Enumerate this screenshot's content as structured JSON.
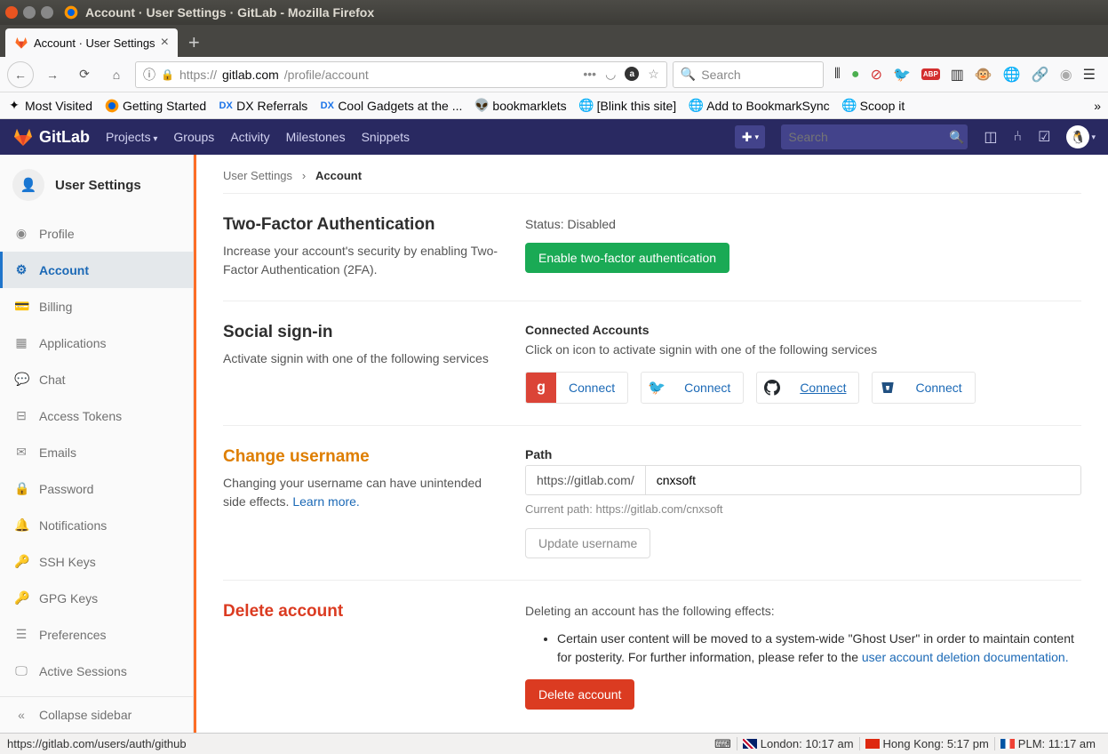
{
  "os": {
    "window_title": "Account · User Settings · GitLab - Mozilla Firefox"
  },
  "browser": {
    "tab_title": "Account · User Settings",
    "url_display": "https://gitlab.com/profile/account",
    "url_host": "gitlab.com",
    "url_protocol": "https://",
    "url_path": "/profile/account",
    "search_placeholder": "Search",
    "bookmarks": {
      "b0": "Most Visited",
      "b1": "Getting Started",
      "b2": "DX Referrals",
      "b3": "Cool Gadgets at the ...",
      "b4": "bookmarklets",
      "b5": "[Blink this site]",
      "b6": "Add to BookmarkSync",
      "b7": "Scoop it"
    }
  },
  "gitlab": {
    "brand": "GitLab",
    "nav": {
      "projects": "Projects",
      "groups": "Groups",
      "activity": "Activity",
      "milestones": "Milestones",
      "snippets": "Snippets"
    },
    "search_placeholder": "Search"
  },
  "sidebar": {
    "title": "User Settings",
    "items": {
      "profile": "Profile",
      "account": "Account",
      "billing": "Billing",
      "applications": "Applications",
      "chat": "Chat",
      "access_tokens": "Access Tokens",
      "emails": "Emails",
      "password": "Password",
      "notifications": "Notifications",
      "ssh_keys": "SSH Keys",
      "gpg_keys": "GPG Keys",
      "preferences": "Preferences",
      "active_sessions": "Active Sessions"
    },
    "collapse": "Collapse sidebar"
  },
  "breadcrumb": {
    "root": "User Settings",
    "current": "Account"
  },
  "twofa": {
    "title": "Two-Factor Authentication",
    "desc": "Increase your account's security by enabling Two-Factor Authentication (2FA).",
    "status": "Status: Disabled",
    "button": "Enable two-factor authentication"
  },
  "social": {
    "title": "Social sign-in",
    "desc": "Activate signin with one of the following services",
    "right_title": "Connected Accounts",
    "right_desc": "Click on icon to activate signin with one of the following services",
    "connect": "Connect"
  },
  "username": {
    "title": "Change username",
    "desc": "Changing your username can have unintended side effects. ",
    "learn": "Learn more.",
    "path_label": "Path",
    "prefix": "https://gitlab.com/",
    "value": "cnxsoft",
    "current": "Current path: https://gitlab.com/cnxsoft",
    "button": "Update username"
  },
  "delete": {
    "title": "Delete account",
    "intro": "Deleting an account has the following effects:",
    "bullet": "Certain user content will be moved to a system-wide \"Ghost User\" in order to maintain content for posterity. For further information, please refer to the ",
    "link": "user account deletion documentation.",
    "button": "Delete account"
  },
  "statusbar": {
    "hover_url": "https://gitlab.com/users/auth/github",
    "london": "London: 10:17 am",
    "hk": "Hong Kong: 5:17 pm",
    "plm": "PLM: 11:17 am"
  }
}
